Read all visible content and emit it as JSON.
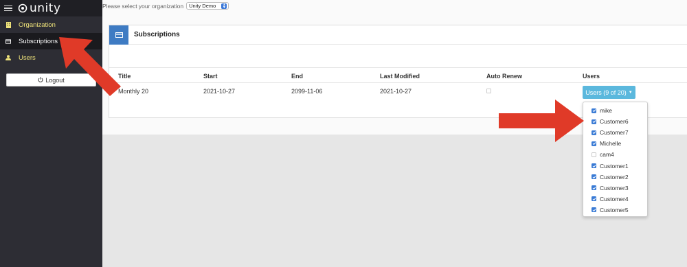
{
  "sidebar": {
    "logo_text": "unity",
    "items": [
      {
        "label": "Organization",
        "icon": "building-icon"
      },
      {
        "label": "Subscriptions",
        "icon": "credit-card-icon"
      },
      {
        "label": "Users",
        "icon": "user-icon"
      }
    ],
    "logout_label": "Logout"
  },
  "org": {
    "prompt": "Please select your organization",
    "selected": "Unity Demo"
  },
  "panel": {
    "title": "Subscriptions"
  },
  "table": {
    "headers": [
      "Title",
      "Start",
      "End",
      "Last Modified",
      "Auto Renew",
      "Users"
    ],
    "rows": [
      {
        "title": "Monthly 20",
        "start": "2021-10-27",
        "end": "2099-11-06",
        "last_modified": "2021-10-27",
        "auto_renew": false,
        "users_button": "Users (9 of 20)"
      }
    ]
  },
  "users_dropdown": {
    "options": [
      {
        "label": "mike",
        "checked": true
      },
      {
        "label": "Customer6",
        "checked": true
      },
      {
        "label": "Customer7",
        "checked": true
      },
      {
        "label": "Michelle",
        "checked": true
      },
      {
        "label": "cam4",
        "checked": false
      },
      {
        "label": "Customer1",
        "checked": true
      },
      {
        "label": "Customer2",
        "checked": true
      },
      {
        "label": "Customer3",
        "checked": true
      },
      {
        "label": "Customer4",
        "checked": true
      },
      {
        "label": "Customer5",
        "checked": true
      }
    ]
  },
  "colors": {
    "sidebar_bg": "#2d2d34",
    "sidebar_accent": "#efe37a",
    "panel_icon": "#3e7bc3",
    "users_button": "#5bb8dd",
    "checkbox_on": "#3a7bd5",
    "annotation_arrow": "#e03a28"
  }
}
